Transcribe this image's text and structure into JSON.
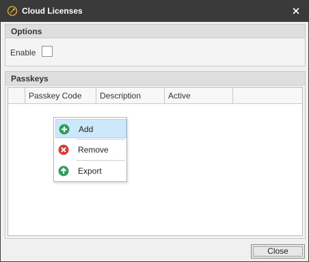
{
  "window": {
    "title": "Cloud Licenses",
    "app_icon": "cloud-license-icon",
    "close_icon": "close-icon"
  },
  "options": {
    "title": "Options",
    "enable_label": "Enable",
    "enable_checked": false
  },
  "passkeys": {
    "title": "Passkeys",
    "columns": [
      "",
      "Passkey Code",
      "Description",
      "Active",
      ""
    ]
  },
  "context_menu": {
    "items": [
      {
        "label": "Add",
        "icon": "add-icon",
        "color": "#2e9e5a"
      },
      {
        "label": "Remove",
        "icon": "remove-icon",
        "color": "#d93a3a"
      },
      {
        "label": "Export",
        "icon": "export-icon",
        "color": "#2e9e5a"
      }
    ],
    "highlight": "#cde8fb"
  },
  "footer": {
    "close_label": "Close"
  }
}
